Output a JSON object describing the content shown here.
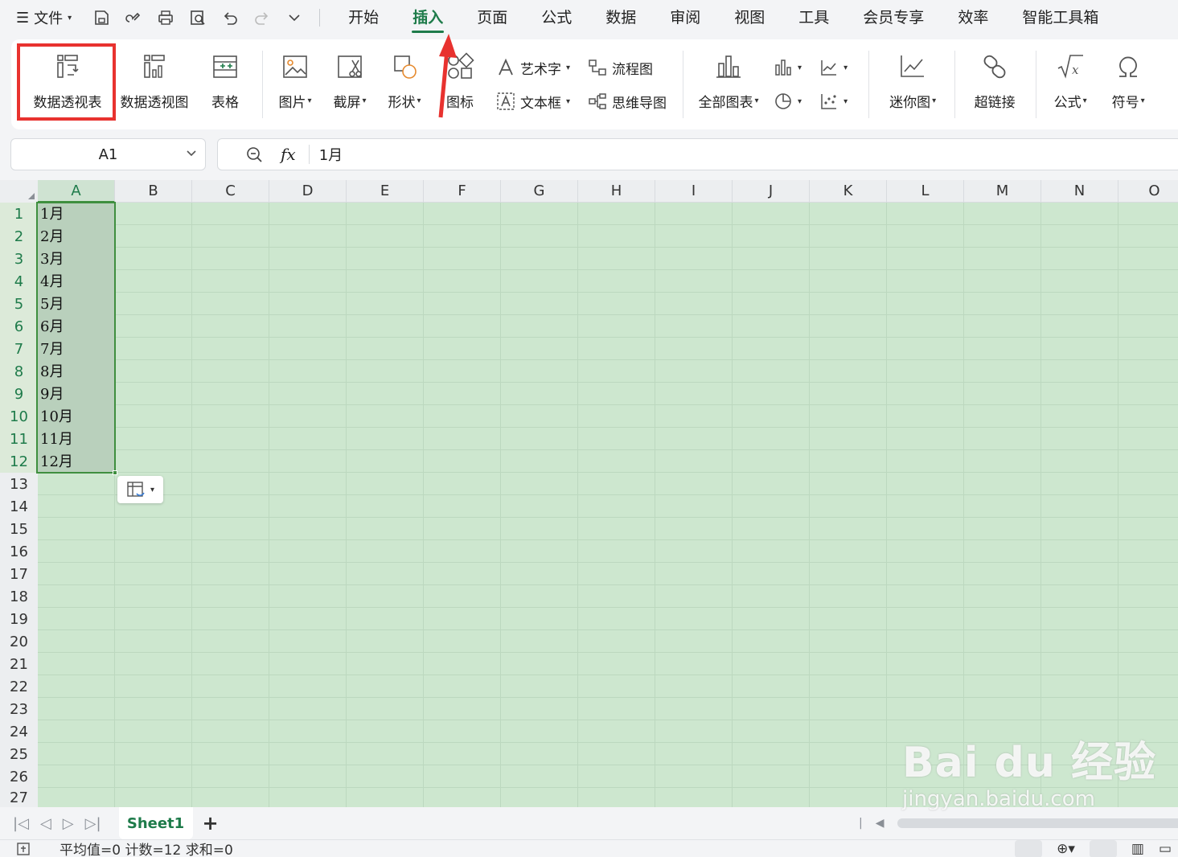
{
  "menubar": {
    "file_label": "文件",
    "tabs": [
      "开始",
      "插入",
      "页面",
      "公式",
      "数据",
      "审阅",
      "视图",
      "工具",
      "会员专享",
      "效率",
      "智能工具箱"
    ],
    "active_tab": "插入"
  },
  "ribbon": {
    "pivot_table": "数据透视表",
    "pivot_chart": "数据透视图",
    "table": "表格",
    "picture": "图片",
    "screenshot": "截屏",
    "shape": "形状",
    "icon": "图标",
    "art_text": "艺术字",
    "textbox": "文本框",
    "flowchart": "流程图",
    "mindmap": "思维导图",
    "all_charts": "全部图表",
    "sparkline": "迷你图",
    "hyperlink": "超链接",
    "formula": "公式",
    "symbol": "符号"
  },
  "formula_bar": {
    "cell_ref": "A1",
    "fx": "fx",
    "value": "1月"
  },
  "grid": {
    "columns": [
      "A",
      "B",
      "C",
      "D",
      "E",
      "F",
      "G",
      "H",
      "I",
      "J",
      "K",
      "L",
      "M",
      "N",
      "O"
    ],
    "rows": [
      "1",
      "2",
      "3",
      "4",
      "5",
      "6",
      "7",
      "8",
      "9",
      "10",
      "11",
      "12",
      "13",
      "14",
      "15",
      "16",
      "17",
      "18",
      "19",
      "20",
      "21",
      "22",
      "23",
      "24",
      "25",
      "26",
      "27"
    ],
    "column_a": [
      "1月",
      "2月",
      "3月",
      "4月",
      "5月",
      "6月",
      "7月",
      "8月",
      "9月",
      "10月",
      "11月",
      "12月"
    ]
  },
  "sheets": {
    "active": "Sheet1",
    "add": "+"
  },
  "status": {
    "summary": "平均值=0  计数=12  求和=0"
  },
  "watermark": {
    "brand": "Bai du 经验",
    "url": "jingyan.baidu.com"
  },
  "colors": {
    "accent": "#1e7b4a",
    "highlight": "#e8322f",
    "sheet_bg": "#cde7cf"
  }
}
